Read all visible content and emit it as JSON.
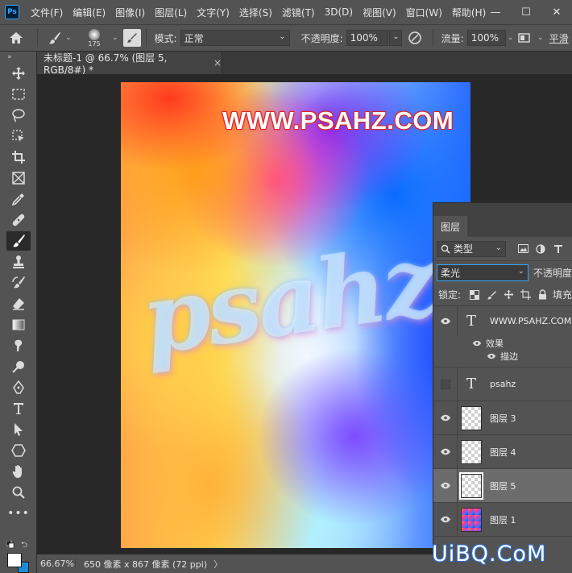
{
  "menubar": {
    "logo": "Ps",
    "items": [
      {
        "label": "文件(F)"
      },
      {
        "label": "编辑(E)"
      },
      {
        "label": "图像(I)"
      },
      {
        "label": "图层(L)"
      },
      {
        "label": "文字(Y)"
      },
      {
        "label": "选择(S)"
      },
      {
        "label": "滤镜(T)"
      },
      {
        "label": "3D(D)"
      },
      {
        "label": "视图(V)"
      },
      {
        "label": "窗口(W)"
      },
      {
        "label": "帮助(H)"
      }
    ],
    "window_controls": {
      "minimize": "—",
      "maximize": "☐",
      "close": "✕"
    }
  },
  "options_bar": {
    "brush_size": "175",
    "mode_label": "模式:",
    "mode_value": "正常",
    "opacity_label": "不透明度:",
    "opacity_value": "100%",
    "flow_label": "流量:",
    "flow_value": "100%",
    "smoothing_label": "平滑"
  },
  "document_tab": {
    "title": "未标题-1 @ 66.7% (图层 5, RGB/8#) *",
    "close": "×"
  },
  "canvas": {
    "title_text": "WWW.PSAHZ.COM",
    "script_text": "psahz"
  },
  "status_bar": {
    "zoom": "66.67%",
    "doc_info": "650 像素 x 867 像素 (72 ppi)",
    "arrow": "〉"
  },
  "layers_panel": {
    "tab_label": "图层",
    "filter_kind": "类型",
    "blend_mode": "柔光",
    "opacity_label": "不透明度",
    "lock_label": "锁定:",
    "fill_label": "填充",
    "layers": [
      {
        "name": "WWW.PSAHZ.COM",
        "kind": "text",
        "visible": true,
        "effects_label": "效果",
        "effect": "描边"
      },
      {
        "name": "psahz",
        "kind": "text",
        "visible": false
      },
      {
        "name": "图层 3",
        "kind": "pixel",
        "visible": true
      },
      {
        "name": "图层 4",
        "kind": "pixel",
        "visible": true
      },
      {
        "name": "图层 5",
        "kind": "pixel",
        "visible": true,
        "selected": true
      },
      {
        "name": "图层 1",
        "kind": "pixel",
        "visible": true
      }
    ]
  },
  "watermark": "UiBQ.CoM",
  "colors": {
    "foreground": "#ffffff",
    "background": "#1b8dd6",
    "accent": "#31a8ff",
    "title_stroke": "#d8262a"
  }
}
